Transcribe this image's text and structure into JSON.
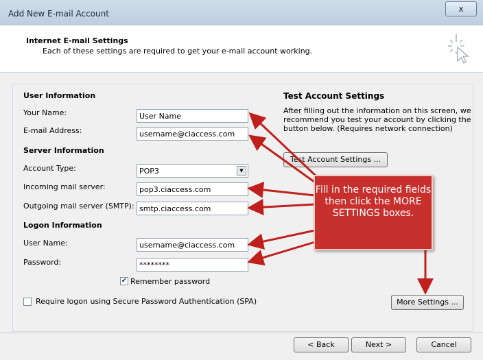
{
  "window": {
    "title": "Add New E-mail Account",
    "close_glyph": "x"
  },
  "header": {
    "title": "Internet E-mail Settings",
    "subtitle": "Each of these settings are required to get your e-mail account working."
  },
  "user_info": {
    "heading": "User Information",
    "name_label": "Your Name:",
    "name_value": "User Name",
    "email_label": "E-mail Address:",
    "email_value": "username@ciaccess.com"
  },
  "server_info": {
    "heading": "Server Information",
    "account_type_label": "Account Type:",
    "account_type_value": "POP3",
    "incoming_label": "Incoming mail server:",
    "incoming_value": "pop3.ciaccess.com",
    "outgoing_label": "Outgoing mail server (SMTP):",
    "outgoing_value": "smtp.ciaccess.com"
  },
  "logon_info": {
    "heading": "Logon Information",
    "username_label": "User Name:",
    "username_value": "username@ciaccess.com",
    "password_label": "Password:",
    "password_value": "********",
    "remember_label": "Remember password",
    "remember_checked": true,
    "spa_label": "Require logon using Secure Password Authentication (SPA)",
    "spa_checked": false
  },
  "test_settings": {
    "heading": "Test Account Settings",
    "description": "After filling out the information on this screen, we recommend you test your account by clicking the button below. (Requires network connection)",
    "button_label": "Test Account Settings ..."
  },
  "more_settings_label": "More Settings ...",
  "callout_text": "Fill in the required fields then click the MORE SETTINGS boxes.",
  "footer": {
    "back_label": "< Back",
    "next_label": "Next >",
    "cancel_label": "Cancel"
  },
  "colors": {
    "callout": "#c7302d",
    "arrow": "#c0201c"
  },
  "icons": {
    "wizard": "wizard-sparkle-icon",
    "dropdown": "chevron-down-icon",
    "check": "checkmark-icon"
  }
}
